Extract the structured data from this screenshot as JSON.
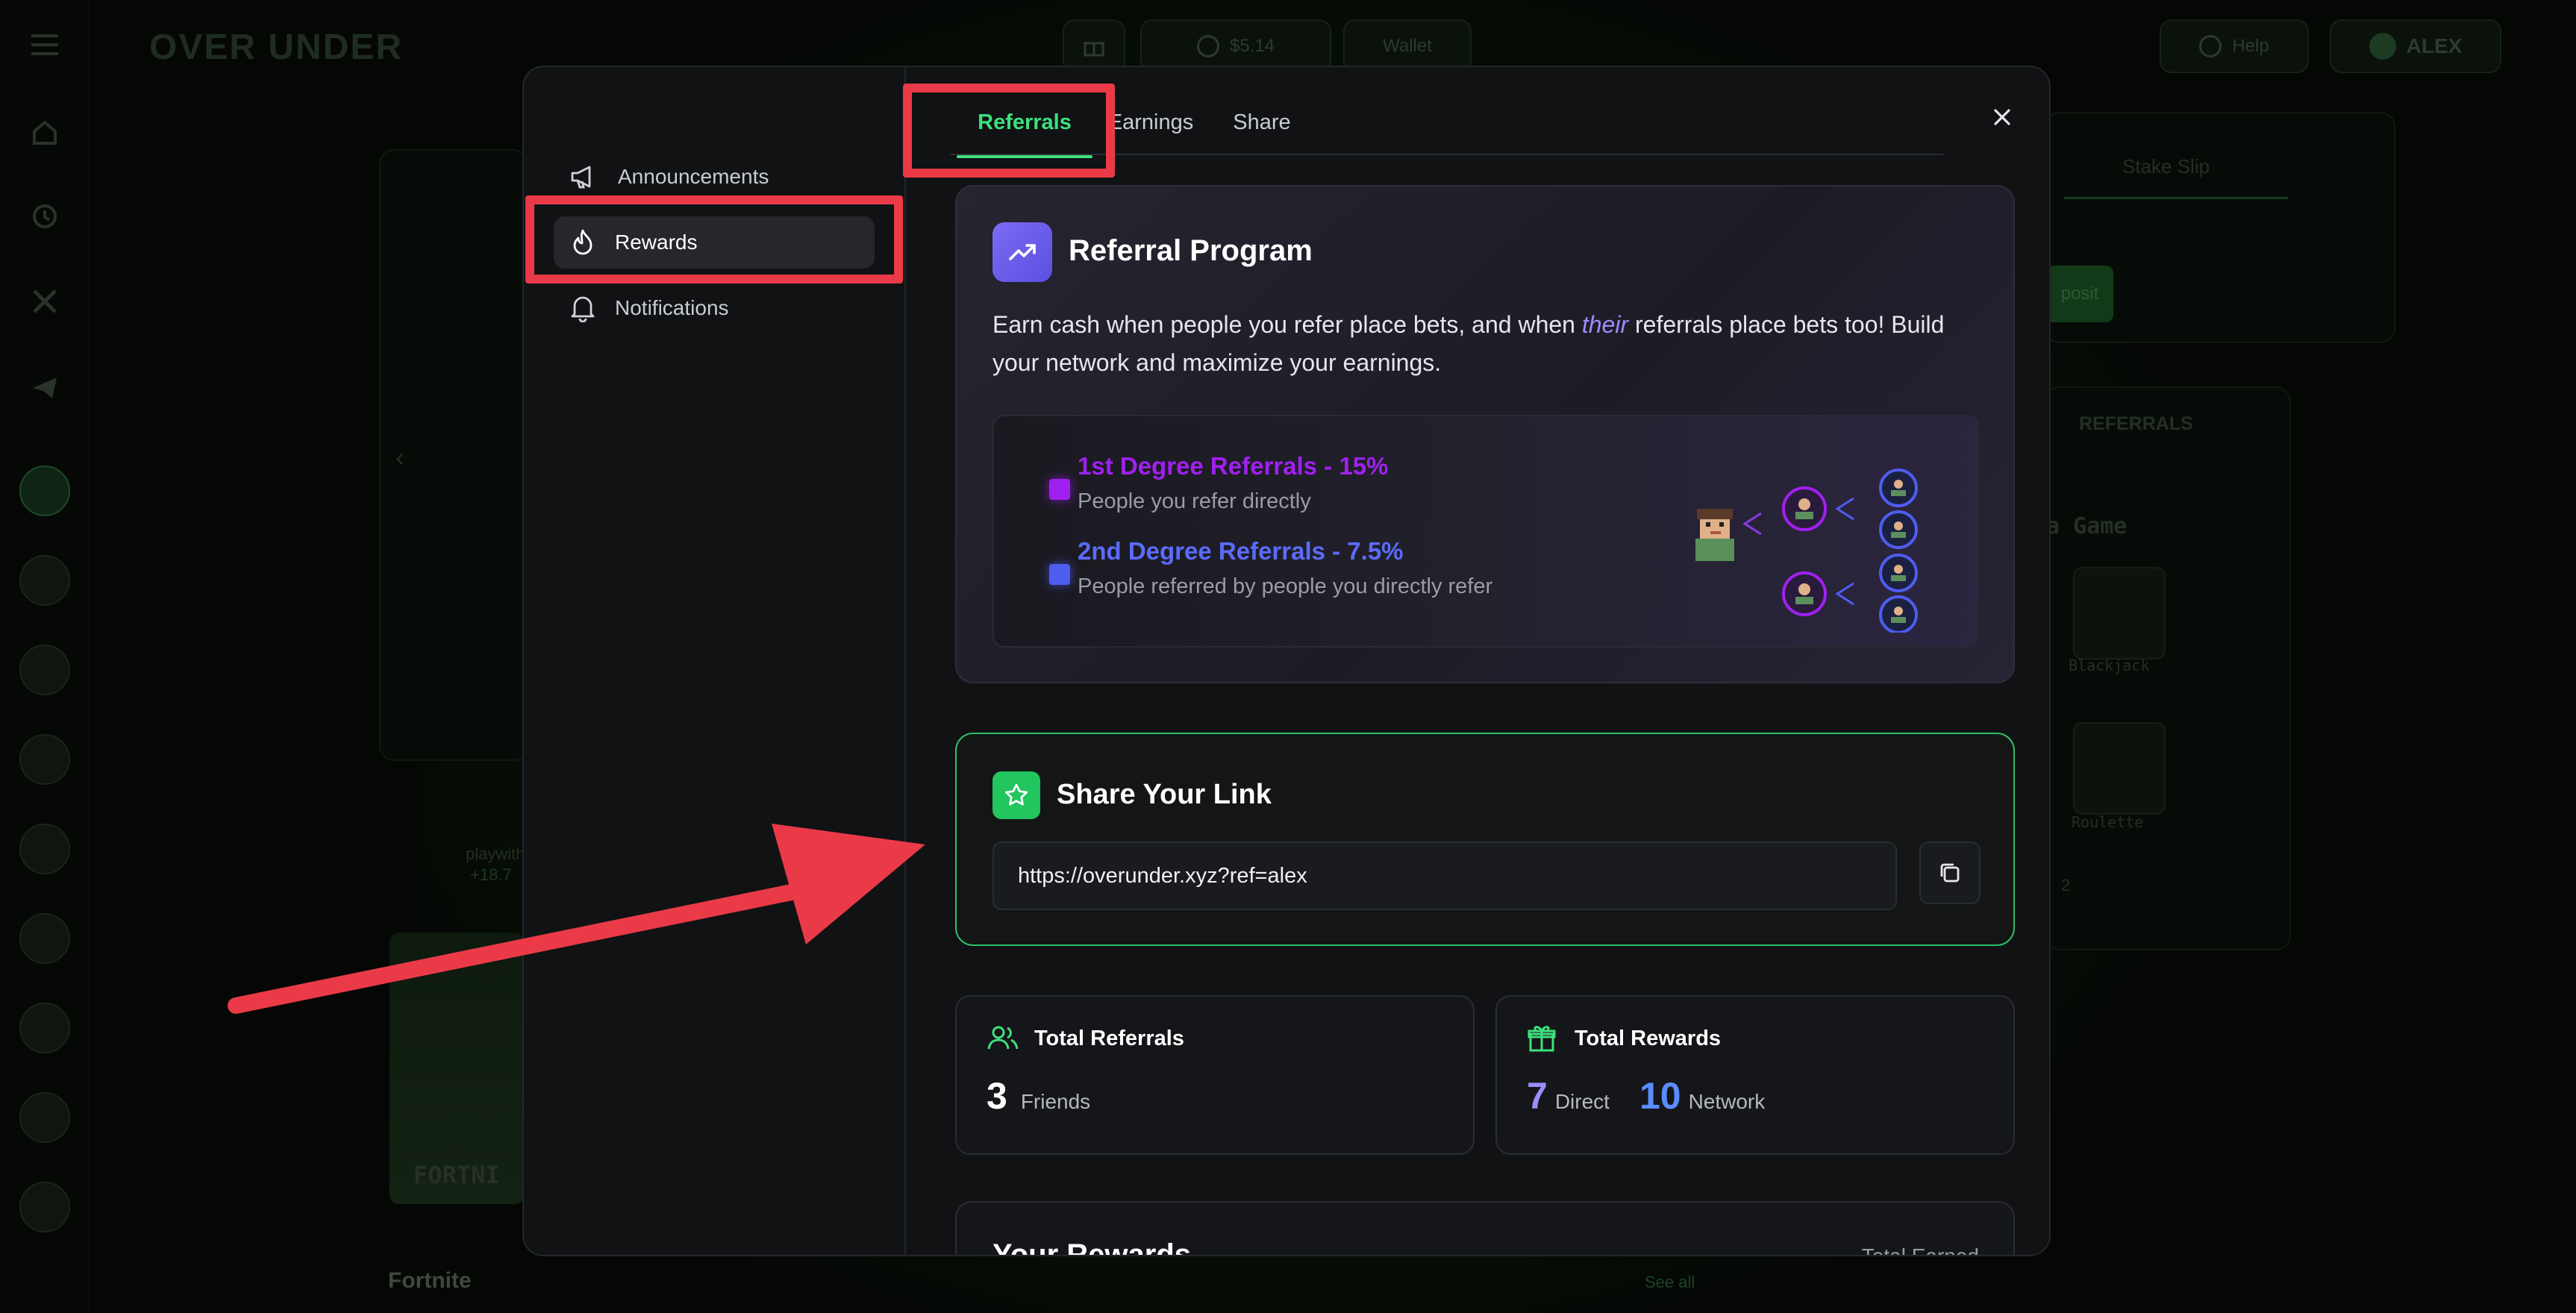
{
  "background": {
    "logo": "OVER UNDER",
    "balance": "$5.14",
    "wallet_label": "Wallet",
    "help_label": "Help",
    "username": "ALEX",
    "stake_slip_label": "Stake Slip",
    "deposit_label": "posit",
    "referrals_label": "REFERRALS",
    "game_heading": "a Game",
    "games": [
      "Blackjack",
      "Roulette"
    ],
    "pager_label": "2",
    "promo_text": "playwith",
    "promo_value": "+18.7",
    "fortnite_banner": "FORTNI",
    "fortnite_label": "Fortnite",
    "see_all_label": "See all"
  },
  "sidebar": {
    "items": [
      {
        "label": "Announcements",
        "icon": "megaphone-icon"
      },
      {
        "label": "Rewards",
        "icon": "flame-icon"
      },
      {
        "label": "Notifications",
        "icon": "bell-icon"
      }
    ]
  },
  "tabs": [
    {
      "label": "Referrals",
      "active": true
    },
    {
      "label": "Earnings",
      "active": false
    },
    {
      "label": "Share",
      "active": false
    }
  ],
  "program": {
    "title": "Referral Program",
    "desc_part1": "Earn cash when people you refer place bets, and when ",
    "desc_emph": "their",
    "desc_part2": " referrals place bets too! Build your network and maximize your earnings.",
    "degrees": [
      {
        "title": "1st Degree Referrals - 15%",
        "subtitle": "People you refer directly",
        "color": "#a020f0"
      },
      {
        "title": "2nd Degree Referrals - 7.5%",
        "subtitle": "People referred by people you directly refer",
        "color": "#5b6bff"
      }
    ]
  },
  "share": {
    "title": "Share Your Link",
    "link": "https://overunder.xyz?ref=alex"
  },
  "stats": {
    "total_referrals_title": "Total Referrals",
    "friends_count": "3",
    "friends_label": "Friends",
    "total_rewards_title": "Total Rewards",
    "direct_count": "7",
    "direct_label": "Direct",
    "network_count": "10",
    "network_label": "Network"
  },
  "rewards": {
    "title": "Your Rewards",
    "total_label": "Total Earned"
  },
  "colors": {
    "accent_green": "#3ee07d",
    "highlight_red": "#ea3a48",
    "purple": "#9b8cff"
  }
}
